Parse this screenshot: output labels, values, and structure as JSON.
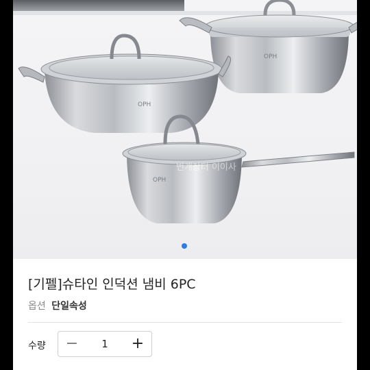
{
  "product": {
    "title": "[기펠]슈타인 인덕션 냄비 6PC",
    "option_label": "옵션",
    "option_value": "단일속성",
    "image_alt": "stainless steel pots with glass lids",
    "brand_mark": "OPH",
    "watermark": "번개장터 이이사"
  },
  "gallery": {
    "current_index": 1,
    "indicator_color": "#2e7be6"
  },
  "quantity": {
    "label": "수량",
    "value": "1",
    "minus_symbol": "−",
    "plus_symbol": "+"
  }
}
